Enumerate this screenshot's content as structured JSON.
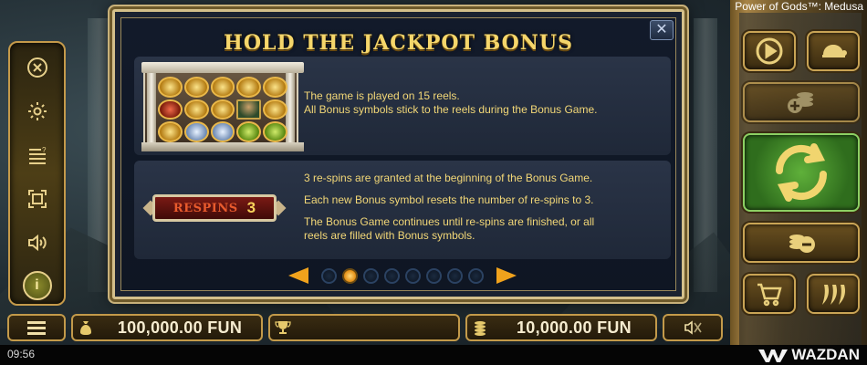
{
  "game_title": "Power of Gods™: Medusa",
  "modal": {
    "title": "HOLD THE JACKPOT BONUS",
    "close_label": "✕",
    "panel1": {
      "line1": "The game is played on 15 reels.",
      "line2": "All Bonus symbols stick to the reels during the Bonus Game."
    },
    "panel2": {
      "line1": "3 re-spins are granted at the beginning of the Bonus Game.",
      "line2": "Each new Bonus symbol resets the number of re-spins to 3.",
      "line3a": "The Bonus Game continues until re-spins are finished, or all",
      "line3b": "reels are filled with Bonus symbols.",
      "respins_label": "RESPINS",
      "respins_value": "3"
    },
    "pagination": {
      "total_pages": 8,
      "current_page": 2
    }
  },
  "left_menu": {
    "items": [
      "close-icon",
      "gear-icon",
      "paytable-icon",
      "fullscreen-icon",
      "sound-icon",
      "info-icon"
    ]
  },
  "bottom_bar": {
    "balance": "100,000.00 FUN",
    "bet": "10,000.00 FUN"
  },
  "status_bar": {
    "time": "09:56",
    "brand": "WAZDAN"
  },
  "colors": {
    "gold_text": "#f2d777",
    "title_gold": "#f5d66b",
    "spin_green": "#5fb03a",
    "pager_orange": "#f0a21c"
  }
}
